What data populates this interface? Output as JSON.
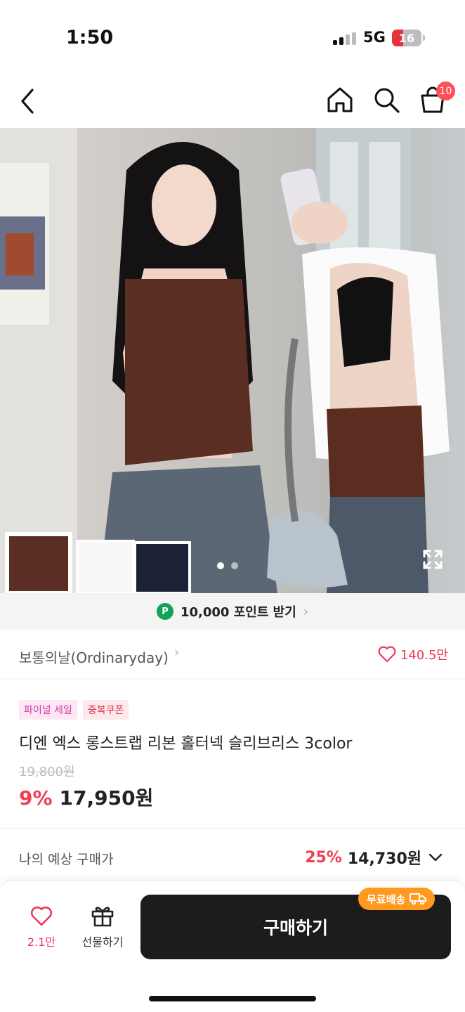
{
  "status": {
    "time": "1:50",
    "network": "5G",
    "battery": "16"
  },
  "nav": {
    "cart_count": "10"
  },
  "hero": {
    "page_total": 2,
    "page_active": 1
  },
  "points": {
    "badge": "P",
    "label": "10,000 포인트 받기"
  },
  "store": {
    "name": "보통의날(Ordinaryday)",
    "likes": "140.5만"
  },
  "tags": [
    "파이널 세일",
    "중복쿠폰"
  ],
  "product": {
    "title": "디엔 엑스 롱스트랩 리본 홀터넥 슬리브리스 3color",
    "original_price": "19,800원",
    "discount": "9%",
    "price": "17,950원"
  },
  "expected": {
    "label": "나의 예상 구매가",
    "discount": "25%",
    "price": "14,730원"
  },
  "bottom": {
    "wish_count": "2.1만",
    "gift_label": "선물하기",
    "buy_label": "구매하기",
    "free_shipping": "무료배송"
  },
  "colors": {
    "accent": "#ef3e53",
    "heart": "#ec3a5a",
    "buy_bg": "#1c1c1c",
    "shipping_badge": "#ff9a1e",
    "points_badge": "#12a35a"
  }
}
